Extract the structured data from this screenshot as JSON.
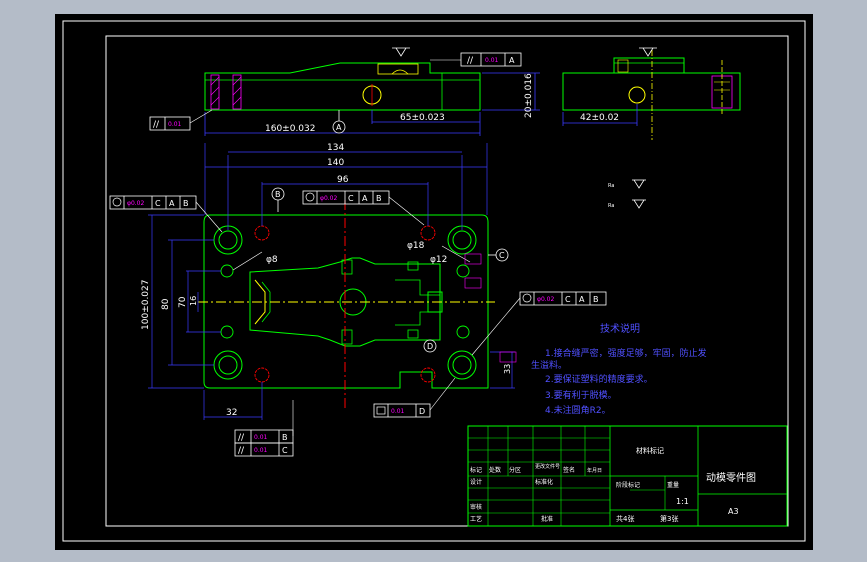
{
  "drawing": {
    "colors": {
      "background": "#000000",
      "outline": "#00ff00",
      "dimension": "#3a3aff",
      "hidden": "#ffff00",
      "centerline": "#ff0000",
      "text": "#ffffff",
      "accent": "#ff00ff"
    },
    "dims": {
      "d160": "160±0.032",
      "d65": "65±0.023",
      "d20": "20±0.016",
      "d42": "42±0.02",
      "d134": "134",
      "d140": "140",
      "d96": "96",
      "d100": "100±0.027",
      "d80": "80",
      "d70": "70",
      "d16": "16",
      "d32": "32",
      "d33": "33",
      "phi8": "φ8",
      "phi12": "φ12",
      "phi18": "φ18"
    },
    "datums": {
      "A": "A",
      "B": "B",
      "C": "C",
      "D": "D"
    },
    "fcf_letters": [
      "A",
      "B",
      "C"
    ],
    "tech_notes": {
      "title": "技术说明",
      "items": [
        "1.接合缝严密，强度足够，牢固，防止发",
        "生溢料。",
        "2.要保证塑料的精度要求。",
        "3.要有利于脱模。",
        "4.未注圆角R2。"
      ]
    },
    "title_block": {
      "part_name": "动模零件图",
      "material_mark": "材料标记",
      "sheet_size": "A3",
      "scale": "1:1",
      "total_sheets": "共4张",
      "sheet_no": "第3张",
      "row_labels": [
        "标记",
        "处数",
        "分区",
        "更改文件号",
        "签名",
        "年月日"
      ],
      "designer": "设计",
      "checker": "审核",
      "process": "工艺",
      "approve": "批准",
      "stage_mark": "阶段标记",
      "weight": "重量",
      "standardize": "标准化"
    }
  }
}
